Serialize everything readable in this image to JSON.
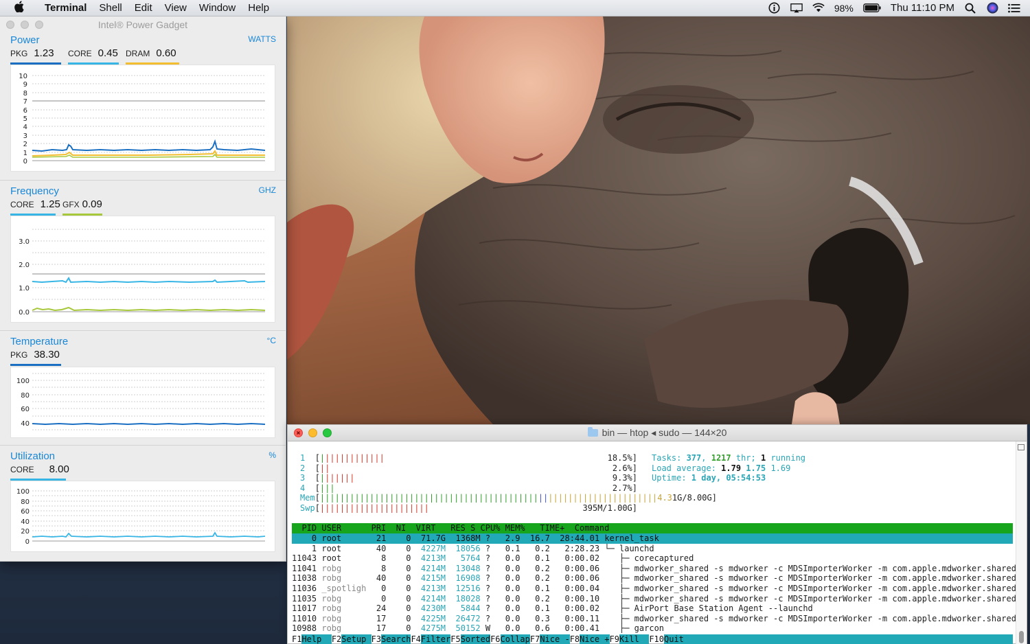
{
  "menubar": {
    "app_name": "Terminal",
    "menus": [
      "Shell",
      "Edit",
      "View",
      "Window",
      "Help"
    ],
    "battery": "98%",
    "clock": "Thu 11:10 PM",
    "icons": [
      "apple-icon",
      "info-icon",
      "airplay-icon",
      "wifi-icon",
      "battery-icon",
      "search-icon",
      "siri-icon",
      "list-icon"
    ]
  },
  "gadget": {
    "title": "Intel® Power Gadget",
    "power": {
      "label": "Power",
      "unit": "WATTS",
      "readouts": [
        {
          "k": "PKG",
          "v": "1.23",
          "color": "#1a6fc2"
        },
        {
          "k": "CORE",
          "v": "0.45",
          "color": "#37b6e6"
        },
        {
          "k": "DRAM",
          "v": "0.60",
          "color": "#f2bd2f"
        }
      ],
      "y_ticks": [
        "10",
        "9",
        "8",
        "7",
        "6",
        "5",
        "4",
        "3",
        "2",
        "1",
        "0"
      ]
    },
    "frequency": {
      "label": "Frequency",
      "unit": "GHZ",
      "readouts": [
        {
          "k": "CORE",
          "v": "1.25",
          "color": "#37b6e6"
        },
        {
          "k": "GFX",
          "v": "0.09",
          "color": "#a7c83a"
        }
      ],
      "y_ticks": [
        "3.0",
        "2.0",
        "1.0",
        "0.0"
      ]
    },
    "temperature": {
      "label": "Temperature",
      "unit": "°C",
      "readouts": [
        {
          "k": "PKG",
          "v": "38.30",
          "color": "#1a6fc2"
        }
      ],
      "y_ticks": [
        "100",
        "80",
        "60",
        "40"
      ]
    },
    "utilization": {
      "label": "Utilization",
      "unit": "%",
      "readouts": [
        {
          "k": "CORE",
          "v": "8.00",
          "color": "#37b6e6"
        }
      ],
      "y_ticks": [
        "100",
        "80",
        "60",
        "40",
        "20",
        "0"
      ]
    }
  },
  "terminal": {
    "title": "bin — htop ◂ sudo — 144×20",
    "cpus": [
      {
        "n": "1",
        "bar": "||||||||||||",
        "bar_color": "red-green",
        "pct": "18.5%]"
      },
      {
        "n": "2",
        "bar": "||",
        "bar_color": "red-green",
        "pct": "2.6%]"
      },
      {
        "n": "3",
        "bar": "||||||",
        "bar_color": "red-green",
        "pct": "9.3%]"
      },
      {
        "n": "4",
        "bar": "|||",
        "bar_color": "red-green",
        "pct": "2.7%]"
      }
    ],
    "mem": {
      "label": "Mem",
      "bar_green": "||||||||||||||||||||||||||||||||||||||||||||",
      "bar_blue": "||",
      "bar_yellow": "||||||||||||||||||||||",
      "value_yel": "4.3",
      "value": "1G/8.00G]"
    },
    "swp": {
      "label": "Swp",
      "bar": "||||||||||||||||||||||",
      "value": "395M/1.00G]"
    },
    "tasks": {
      "label": "Tasks: ",
      "count": "377",
      "sep": ", ",
      "thr": "1217",
      "thr_label": " thr; ",
      "running": "1",
      "running_label": " running"
    },
    "load": {
      "label": "Load average: ",
      "v1": "1.79",
      "v2": "1.75",
      "v3": "1.69"
    },
    "uptime": {
      "label": "Uptime: ",
      "value": "1 day, 05:54:53"
    },
    "header": "  PID USER      PRI  NI  VIRT   RES S CPU% MEM%   TIME+  Command",
    "processes": [
      {
        "pid": "    0",
        "user": "root     ",
        "pri": " 21",
        "ni": "   0",
        "virt": " 71.7G",
        "res": " 1368M",
        "s": "?",
        "cpu": "  2.9",
        "mem": " 16.7",
        "time": " 28:44.01",
        "cmd": "kernel_task",
        "selected": true
      },
      {
        "pid": "    1",
        "user": "root     ",
        "pri": " 40",
        "ni": "   0",
        "virt": " 4227M",
        "res": " 18056",
        "s": "?",
        "cpu": "  0.1",
        "mem": "  0.2",
        "time": "  2:28.23",
        "cmd": "└─ launchd"
      },
      {
        "pid": "11043",
        "user": "root     ",
        "pri": "  8",
        "ni": "   0",
        "virt": " 4213M",
        "res": "  5764",
        "s": "?",
        "cpu": "  0.0",
        "mem": "  0.1",
        "time": "  0:00.02",
        "cmd": "   ├─ corecaptured"
      },
      {
        "pid": "11041",
        "user": "robg     ",
        "pri": "  8",
        "ni": "   0",
        "virt": " 4214M",
        "res": " 13048",
        "s": "?",
        "cpu": "  0.0",
        "mem": "  0.2",
        "time": "  0:00.06",
        "cmd": "   ├─ mdworker_shared -s mdworker -c MDSImporterWorker -m com.apple.mdworker.shared"
      },
      {
        "pid": "11038",
        "user": "robg     ",
        "pri": " 40",
        "ni": "   0",
        "virt": " 4215M",
        "res": " 16908",
        "s": "?",
        "cpu": "  0.0",
        "mem": "  0.2",
        "time": "  0:00.06",
        "cmd": "   ├─ mdworker_shared -s mdworker -c MDSImporterWorker -m com.apple.mdworker.shared"
      },
      {
        "pid": "11036",
        "user": "_spotligh",
        "pri": "  0",
        "ni": "   0",
        "virt": " 4213M",
        "res": " 12516",
        "s": "?",
        "cpu": "  0.0",
        "mem": "  0.1",
        "time": "  0:00.04",
        "cmd": "   ├─ mdworker_shared -s mdworker -c MDSImporterWorker -m com.apple.mdworker.shared"
      },
      {
        "pid": "11035",
        "user": "robg     ",
        "pri": "  0",
        "ni": "   0",
        "virt": " 4214M",
        "res": " 18028",
        "s": "?",
        "cpu": "  0.0",
        "mem": "  0.2",
        "time": "  0:00.10",
        "cmd": "   ├─ mdworker_shared -s mdworker -c MDSImporterWorker -m com.apple.mdworker.shared"
      },
      {
        "pid": "11017",
        "user": "robg     ",
        "pri": " 24",
        "ni": "   0",
        "virt": " 4230M",
        "res": "  5844",
        "s": "?",
        "cpu": "  0.0",
        "mem": "  0.1",
        "time": "  0:00.02",
        "cmd": "   ├─ AirPort Base Station Agent --launchd"
      },
      {
        "pid": "11010",
        "user": "robg     ",
        "pri": " 17",
        "ni": "   0",
        "virt": " 4225M",
        "res": " 26472",
        "s": "?",
        "cpu": "  0.0",
        "mem": "  0.3",
        "time": "  0:00.11",
        "cmd": "   ├─ mdworker_shared -s mdworker -c MDSImporterWorker -m com.apple.mdworker.shared"
      },
      {
        "pid": "10988",
        "user": "robg     ",
        "pri": " 17",
        "ni": "   0",
        "virt": " 4275M",
        "res": " 50152",
        "s": "W",
        "cpu": "  0.0",
        "mem": "  0.6",
        "time": "  0:00.41",
        "cmd": "   ├─ garcon"
      }
    ],
    "fkeys": [
      {
        "k": "F1",
        "l": "Help  "
      },
      {
        "k": "F2",
        "l": "Setup "
      },
      {
        "k": "F3",
        "l": "Search"
      },
      {
        "k": "F4",
        "l": "Filter"
      },
      {
        "k": "F5",
        "l": "Sorted"
      },
      {
        "k": "F6",
        "l": "Collap"
      },
      {
        "k": "F7",
        "l": "Nice -"
      },
      {
        "k": "F8",
        "l": "Nice +"
      },
      {
        "k": "F9",
        "l": "Kill  "
      },
      {
        "k": "F10",
        "l": "Quit  "
      }
    ]
  },
  "colors": {
    "accent_blue": "#1887d8",
    "htop_green": "#16a51c",
    "htop_cyan": "#22a9b7"
  }
}
